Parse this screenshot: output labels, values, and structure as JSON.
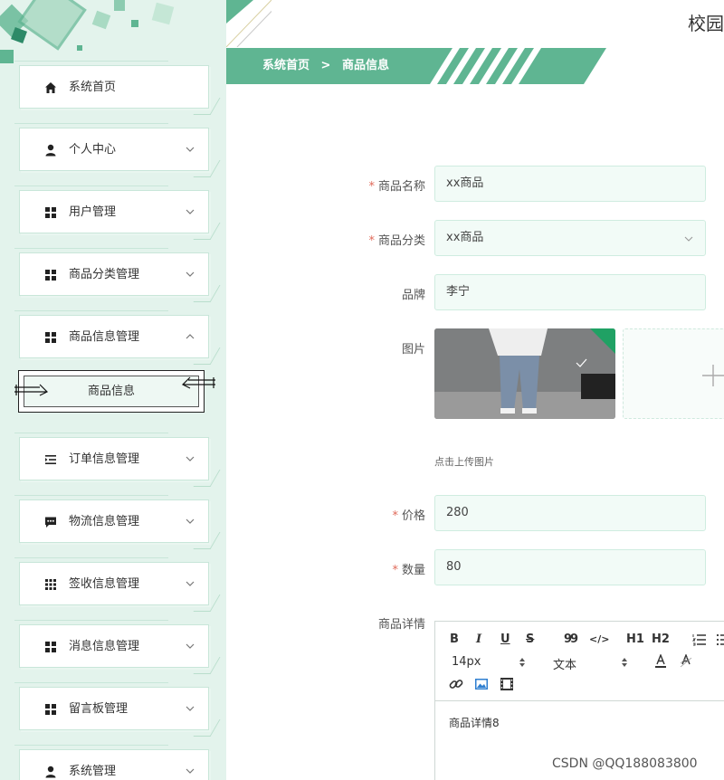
{
  "header": {
    "site_title": "校园",
    "breadcrumb_home": "系统首页",
    "breadcrumb_sep": ">",
    "breadcrumb_current": "商品信息"
  },
  "sidebar": {
    "items": [
      {
        "label": "系统首页",
        "icon": "home-icon"
      },
      {
        "label": "个人中心",
        "icon": "user-icon"
      },
      {
        "label": "用户管理",
        "icon": "grid-icon"
      },
      {
        "label": "商品分类管理",
        "icon": "grid-icon"
      },
      {
        "label": "商品信息管理",
        "icon": "grid-icon"
      },
      {
        "label": "订单信息管理",
        "icon": "list-indent-icon"
      },
      {
        "label": "物流信息管理",
        "icon": "chat-icon"
      },
      {
        "label": "签收信息管理",
        "icon": "apps-icon"
      },
      {
        "label": "消息信息管理",
        "icon": "grid-icon"
      },
      {
        "label": "留言板管理",
        "icon": "grid-icon"
      },
      {
        "label": "系统管理",
        "icon": "user-icon"
      }
    ],
    "sub_item": "商品信息"
  },
  "form": {
    "required_mark": "*",
    "name_label": "商品名称",
    "name_value": "xx商品",
    "category_label": "商品分类",
    "category_value": "xx商品",
    "brand_label": "品牌",
    "brand_value": "李宁",
    "image_label": "图片",
    "upload_hint": "点击上传图片",
    "price_label": "价格",
    "price_value": "280",
    "qty_label": "数量",
    "qty_value": "80",
    "detail_label": "商品详情"
  },
  "editor": {
    "bold": "B",
    "italic": "I",
    "underline": "U",
    "strike": "S",
    "quote": "99",
    "code": "</>",
    "h1": "H1",
    "h2": "H2",
    "font_size": "14px",
    "paragraph": "文本",
    "content": "商品详情8"
  },
  "watermark": "CSDN @QQ188083800",
  "colors": {
    "accent": "#5fb592",
    "sidebar_bg": "#e3f3ec",
    "field_bg": "#f2fbf7",
    "required": "#e06a5a"
  }
}
